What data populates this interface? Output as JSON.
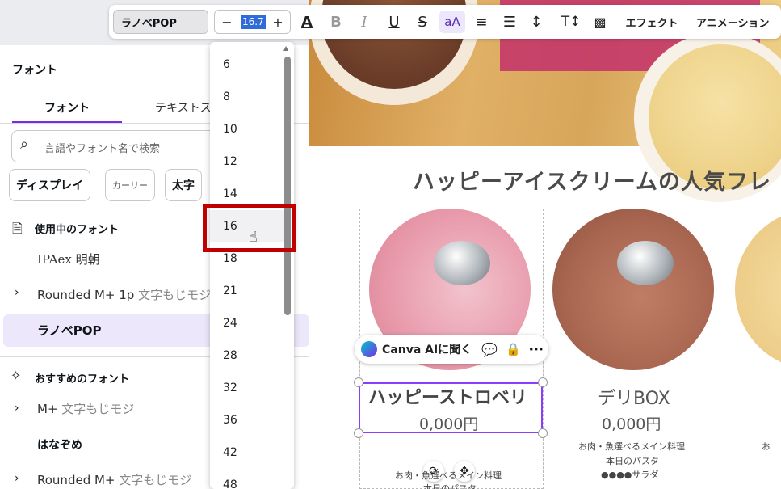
{
  "toolbar": {
    "font_name": "ラノベPOP",
    "minus": "−",
    "size_value": "16.7",
    "plus": "+",
    "effects": "エフェクト",
    "animation": "アニメーション",
    "case_label": "aA"
  },
  "panel": {
    "title": "フォント",
    "tab_font": "フォント",
    "tab_style": "テキストス",
    "search_placeholder": "言語やフォント名で検索",
    "chips": [
      "ディスプレイ",
      "カーリー",
      "太字"
    ],
    "in_use_heading": "使用中のフォント",
    "in_use": [
      {
        "name": "IPAex 明朝",
        "sub": ""
      },
      {
        "name": "Rounded M+ 1p",
        "sub": "文字もじモジ"
      },
      {
        "name": "ラノベPOP",
        "sub": ""
      }
    ],
    "recommended_heading": "おすすめのフォント",
    "recommended": [
      {
        "name": "M+",
        "sub": "文字もじモジ"
      },
      {
        "name": "はなぞめ",
        "sub": ""
      },
      {
        "name": "Rounded M+",
        "sub": "文字もじモジ"
      }
    ]
  },
  "dropdown": {
    "sizes": [
      "6",
      "8",
      "10",
      "12",
      "14",
      "16",
      "18",
      "21",
      "24",
      "28",
      "32",
      "36",
      "42",
      "48"
    ],
    "highlighted": "16"
  },
  "canvas": {
    "heading": "ハッピーアイスクリームの人気フレ",
    "ai_button": "Canva AIに聞く",
    "products": [
      {
        "title": "ハッピーストロベリ",
        "price": "0,000円",
        "line1": "お肉・魚選べるメイン料理",
        "line2": "本日のパスタ"
      },
      {
        "title": "デリBOX",
        "price": "0,000円",
        "line1": "お肉・魚選べるメイン料理",
        "line2": "本日のパスタ",
        "line3": "●●●●サラダ"
      },
      {
        "title": "",
        "price": "",
        "line1": "お"
      }
    ]
  },
  "colors": {
    "accent": "#7d2ae8",
    "highlight_box": "#c00000",
    "strawberry": "#e69aa8",
    "chocolate": "#a86650"
  }
}
